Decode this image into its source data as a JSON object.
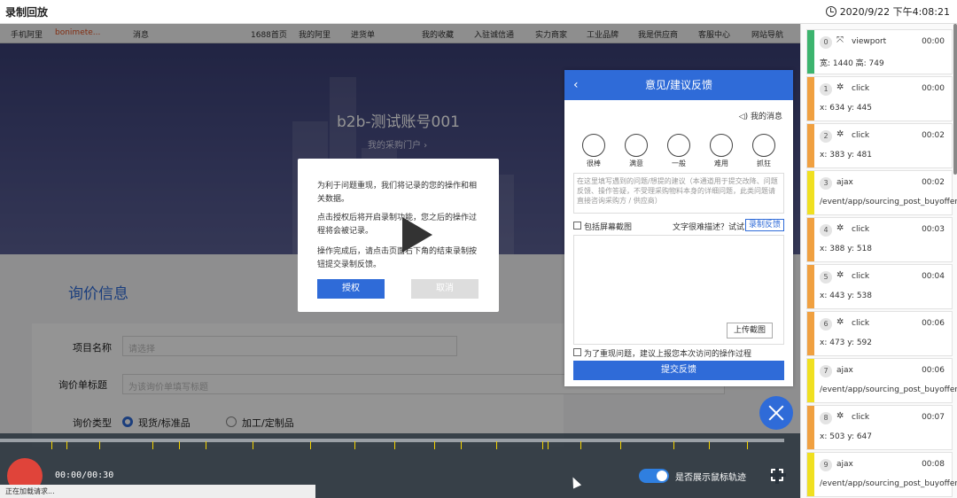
{
  "window": {
    "title": "录制回放",
    "datetime": "2020/9/22 下午4:08:21"
  },
  "topnav": {
    "left": [
      "手机阿里",
      "bonimete...",
      "消息"
    ],
    "right": [
      "1688首页",
      "我的阿里",
      "进货单",
      "我的收藏",
      "入驻诚信通",
      "实力商家",
      "工业品牌",
      "我是供应商",
      "客服中心",
      "网站导航"
    ]
  },
  "hero": {
    "title": "b2b-测试账号001",
    "link": "我的采购门户 ›"
  },
  "form": {
    "section_title": "询价信息",
    "project_label": "项目名称",
    "project_placeholder": "请选择",
    "subject_label": "询价单标题",
    "subject_placeholder": "为该询价单填写标题",
    "type_label": "询价类型",
    "type_options": [
      "现货/标准品",
      "加工/定制品"
    ]
  },
  "dialog": {
    "p1": "为利于问题重现，我们将记录的您的操作和相关数据。",
    "p2": "点击授权后将开启录制功能，您之后的操作过程将会被记录。",
    "p3": "操作完成后，请点击页面右下角的结束录制按钮提交录制反馈。",
    "authorize": "授权",
    "cancel": "取消"
  },
  "feedback": {
    "title": "意见/建议反馈",
    "my_messages": "我的消息",
    "emotions": [
      "很棒",
      "满意",
      "一般",
      "难用",
      "抓狂"
    ],
    "placeholder": "在这里填写遇到的问题/想提的建议（本通道用于提交改降、问题反馈、操作答疑，不受理采购物料本身的详细问题，此类问题请直接咨询采购方 / 供应商）",
    "include_screenshot": "包括屏幕截图",
    "hint": "文字很难描述？试试",
    "record_btn": "录制反馈",
    "upload_btn": "上传截图",
    "reproduce": "为了重现问题，建议上报您本次访问的操作过程",
    "submit": "提交反馈"
  },
  "controls": {
    "time": "00:00/00:30",
    "toggle_label": "是否展示鼠标轨迹",
    "loading": "正在加载请求..."
  },
  "events": [
    {
      "n": "0",
      "type": "viewport",
      "time": "00:00",
      "detail": "宽: 1440 高: 749",
      "color": "#3cb46e",
      "icon": "fullscreen-icon"
    },
    {
      "n": "1",
      "type": "click",
      "time": "00:00",
      "detail": "x: 634 y: 445",
      "color": "#f0a040",
      "icon": "click-icon"
    },
    {
      "n": "2",
      "type": "click",
      "time": "00:02",
      "detail": "x: 383 y: 481",
      "color": "#f0a040",
      "icon": "click-icon"
    },
    {
      "n": "3",
      "type": "ajax",
      "time": "00:02",
      "detail": "/event/app/sourcing_post_buyoffer",
      "color": "#f0e020",
      "icon": ""
    },
    {
      "n": "4",
      "type": "click",
      "time": "00:03",
      "detail": "x: 388 y: 518",
      "color": "#f0a040",
      "icon": "click-icon"
    },
    {
      "n": "5",
      "type": "click",
      "time": "00:04",
      "detail": "x: 443 y: 538",
      "color": "#f0a040",
      "icon": "click-icon"
    },
    {
      "n": "6",
      "type": "click",
      "time": "00:06",
      "detail": "x: 473 y: 592",
      "color": "#f0a040",
      "icon": "click-icon"
    },
    {
      "n": "7",
      "type": "ajax",
      "time": "00:06",
      "detail": "/event/app/sourcing_post_buyoffer",
      "color": "#f0e020",
      "icon": ""
    },
    {
      "n": "8",
      "type": "click",
      "time": "00:07",
      "detail": "x: 503 y: 647",
      "color": "#f0a040",
      "icon": "click-icon"
    },
    {
      "n": "9",
      "type": "ajax",
      "time": "00:08",
      "detail": "/event/app/sourcing_post_buyoffer",
      "color": "#f0e020",
      "icon": ""
    }
  ]
}
